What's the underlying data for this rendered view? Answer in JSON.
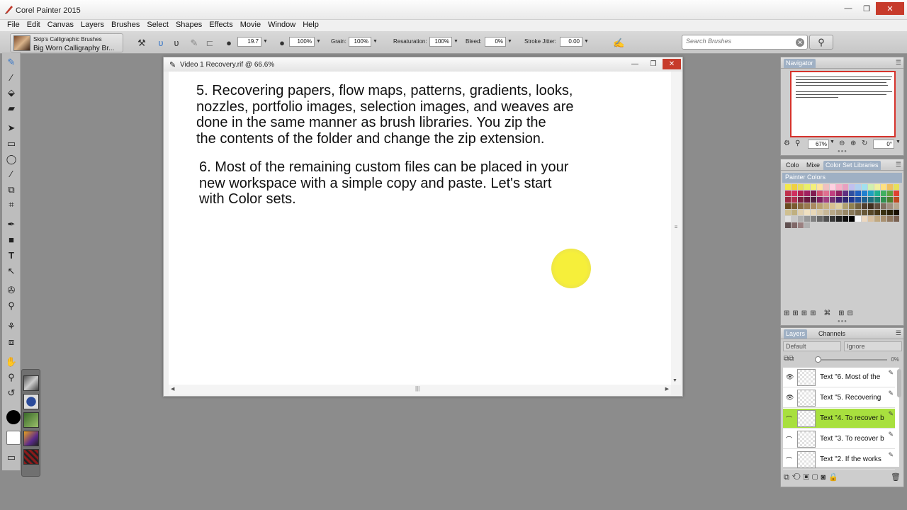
{
  "app": {
    "title": "Corel Painter 2015"
  },
  "menu": [
    "File",
    "Edit",
    "Canvas",
    "Layers",
    "Brushes",
    "Select",
    "Shapes",
    "Effects",
    "Movie",
    "Window",
    "Help"
  ],
  "brush": {
    "category": "Skip's Calligraphic Brushes",
    "variant": "Big Worn Calligraphy Br..."
  },
  "props": {
    "size": "19.7",
    "opacity": "100%",
    "grain_label": "Grain:",
    "grain": "100%",
    "resaturation_label": "Resaturation:",
    "resaturation": "100%",
    "bleed_label": "Bleed:",
    "bleed": "0%",
    "jitter_label": "Stroke Jitter:",
    "jitter": "0.00"
  },
  "search": {
    "placeholder": "Search Brushes"
  },
  "document": {
    "title": "Video 1 Recovery.rif @ 66.6%",
    "para5": [
      "5.  Recovering papers, flow maps, patterns, gradients, looks,",
      "nozzles, portfolio images, selection images, and weaves are",
      "done in the same manner as brush libraries.  You zip the",
      "the contents of the folder and change the zip extension."
    ],
    "para6": [
      "6.  Most of the remaining custom files can be placed in your",
      "new workspace with a simple copy and paste.  Let's start",
      "with Color sets."
    ]
  },
  "navigator": {
    "tab": "Navigator",
    "zoom": "67%",
    "rotation": "0°"
  },
  "colors_panel": {
    "tabs": [
      "Colo",
      "Mixe",
      "Color Set Libraries"
    ],
    "set_name": "Painter Colors",
    "swatches": [
      "#f3e84a",
      "#f0d040",
      "#e8e05a",
      "#eaf06a",
      "#f4f07a",
      "#ffe3a0",
      "#f0c0c0",
      "#ffd0e0",
      "#f7b0c8",
      "#e8a0c0",
      "#c0c0f0",
      "#b0d0f0",
      "#a0e0f0",
      "#d0f0b0",
      "#f0f0a0",
      "#ffe080",
      "#f0c060",
      "#e7e05a",
      "#c0304a",
      "#d03060",
      "#b02050",
      "#a02060",
      "#801c50",
      "#d05070",
      "#e07090",
      "#c04080",
      "#902060",
      "#603080",
      "#3050a0",
      "#2060c0",
      "#2080d0",
      "#20a0c0",
      "#20b090",
      "#40b060",
      "#60a040",
      "#e04030",
      "#9a2a40",
      "#b03050",
      "#7a2040",
      "#6a1a40",
      "#502040",
      "#802060",
      "#a04080",
      "#703070",
      "#402070",
      "#302870",
      "#203890",
      "#2050a0",
      "#206090",
      "#207080",
      "#208070",
      "#309050",
      "#508030",
      "#c04a20",
      "#6a4a20",
      "#7a5a30",
      "#8a6a40",
      "#9a7a50",
      "#aa8a60",
      "#baa070",
      "#c8b080",
      "#d8c090",
      "#e0d0a0",
      "#b0a070",
      "#908050",
      "#706040",
      "#504030",
      "#403020",
      "#605040",
      "#807060",
      "#a09080",
      "#b8a890",
      "#d0c090",
      "#c0b080",
      "#e0d0b0",
      "#f0e0c0",
      "#e8d8b8",
      "#d8c8a8",
      "#c8b898",
      "#b8a888",
      "#a89878",
      "#988868",
      "#887858",
      "#786848",
      "#685838",
      "#584828",
      "#483818",
      "#383010",
      "#282008",
      "#181000",
      "#e0e0e0",
      "#c8c8c8",
      "#b0b0b0",
      "#989898",
      "#808080",
      "#686868",
      "#505050",
      "#383838",
      "#202020",
      "#101010",
      "#000000",
      "#f8f8f8",
      "#ecd8c0",
      "#d8c0a0",
      "#c0a880",
      "#a89070",
      "#907860",
      "#786050",
      "#605050",
      "#806868",
      "#9a8080",
      "#b0b0b0"
    ]
  },
  "layers": {
    "tabs": [
      "Layers",
      "Channels"
    ],
    "composite_method": "Default",
    "composite_depth": "Ignore",
    "opacity": "0%",
    "items": [
      {
        "name": "Text \"6.  Most of the",
        "visible": true,
        "active": false
      },
      {
        "name": "Text \"5.  Recovering",
        "visible": true,
        "active": false
      },
      {
        "name": "Text \"4.  To recover b",
        "visible": false,
        "active": true
      },
      {
        "name": "Text \"3.  To recover b",
        "visible": false,
        "active": false
      },
      {
        "name": "Text \"2.  If the works",
        "visible": false,
        "active": false
      }
    ]
  }
}
